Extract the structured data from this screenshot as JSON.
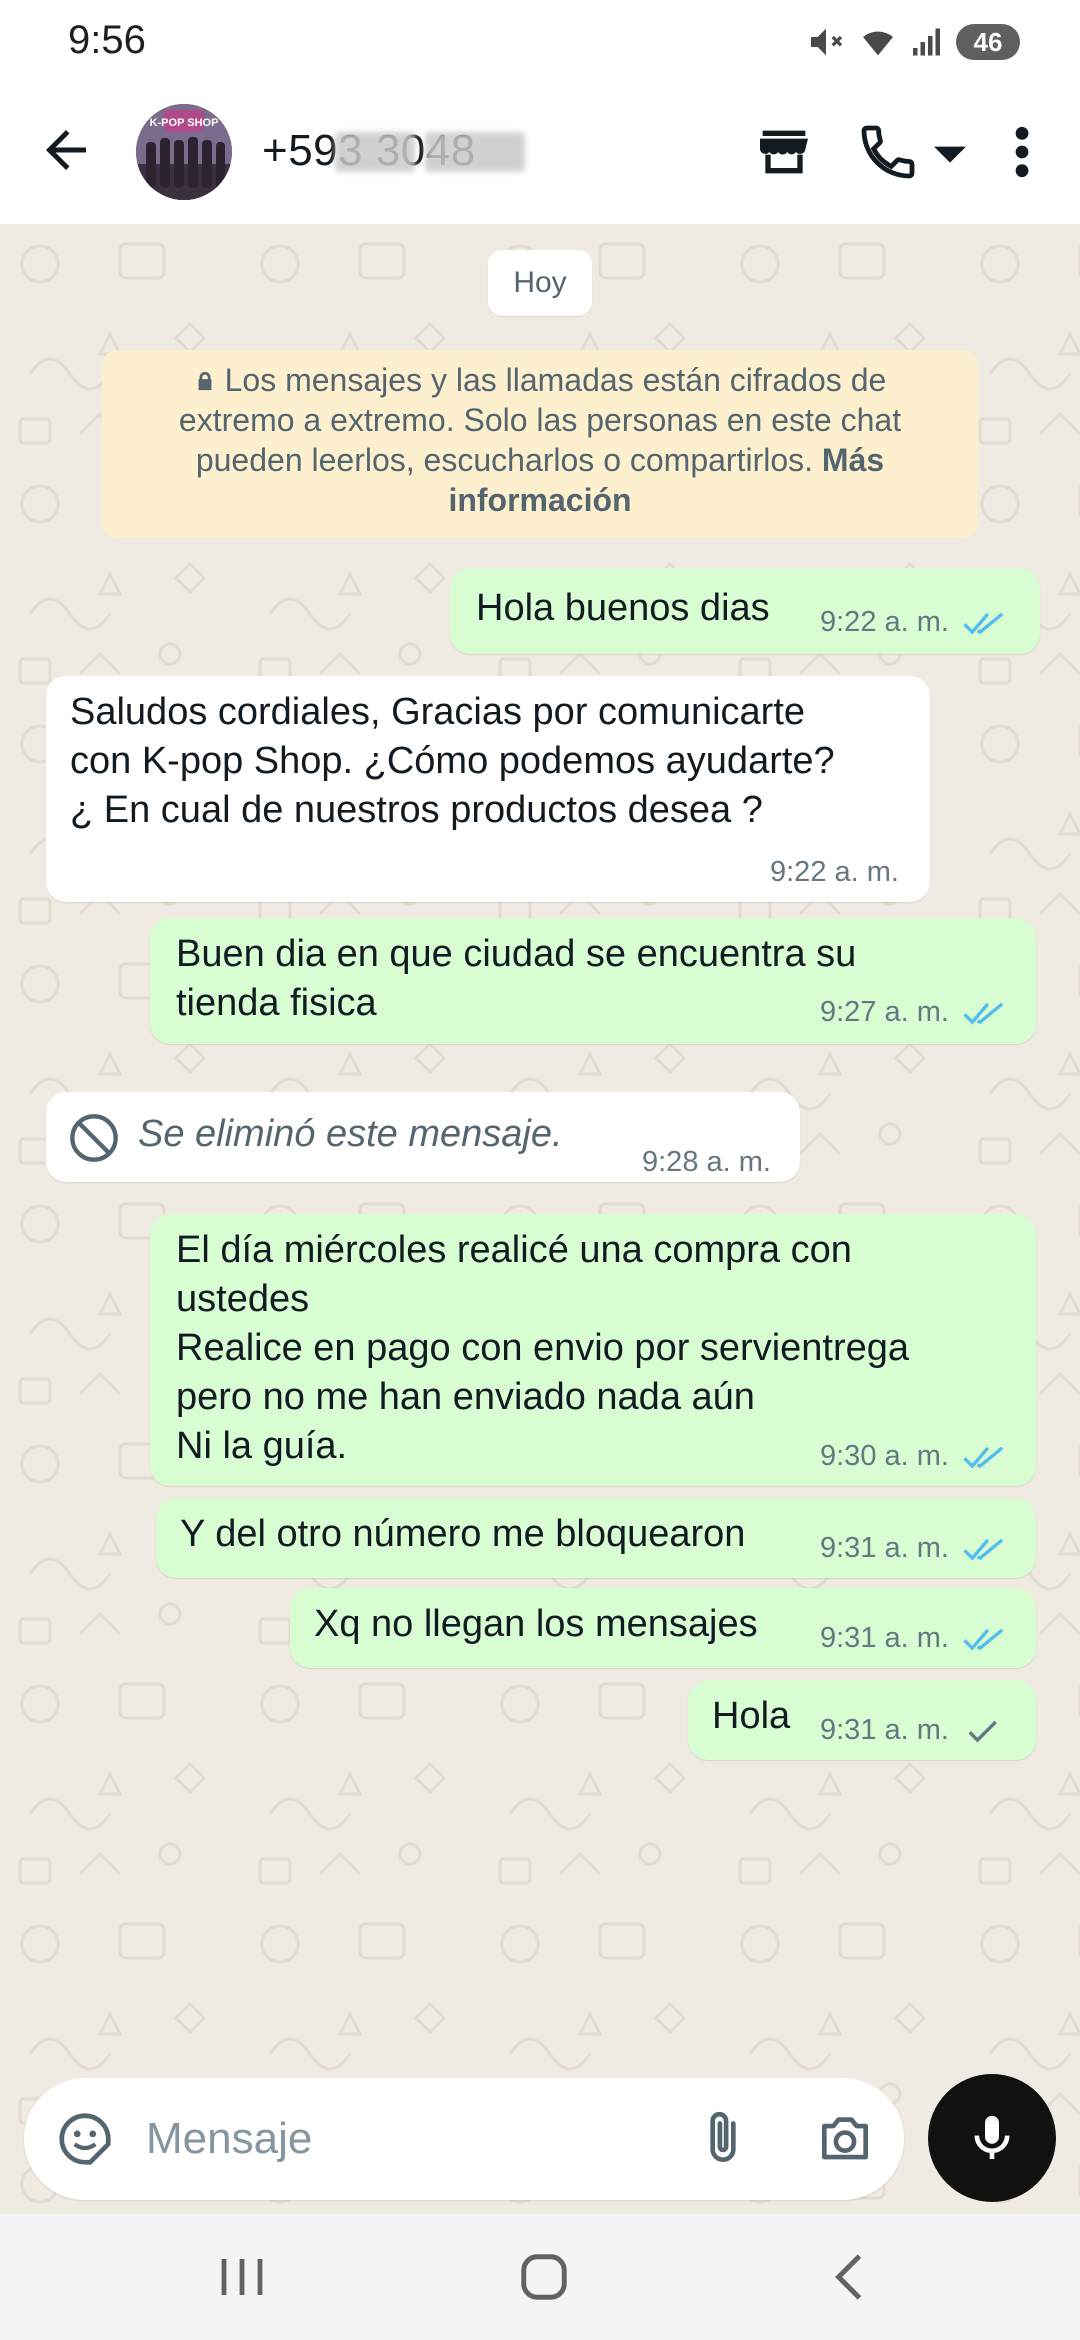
{
  "status_bar": {
    "time": "9:56",
    "battery": "46",
    "icons": [
      "mute-icon",
      "wifi-icon",
      "signal-icon",
      "battery-icon"
    ]
  },
  "header": {
    "back_icon": "arrow-left-icon",
    "avatar_label": "K-POP SHOP",
    "contact_name": "+593          3048",
    "actions": [
      "store-icon",
      "phone-icon",
      "dropdown-icon",
      "more-vert-icon"
    ]
  },
  "chat": {
    "date_chip": "Hoy",
    "encryption_notice": {
      "text": "Los mensajes y las llamadas están cifrados de extremo a extremo. Solo las personas en este chat pueden leerlos, escucharlos o compartirlos.",
      "link": "Más información"
    },
    "messages": [
      {
        "direction": "out",
        "text": "Hola buenos dias",
        "time": "9:22 a. m.",
        "status": "read"
      },
      {
        "direction": "in",
        "text": "Saludos cordiales, Gracias por comunicarte\ncon K-pop Shop. ¿Cómo podemos ayudarte?\n¿ En cual de nuestros productos desea ?",
        "time": "9:22 a. m."
      },
      {
        "direction": "out",
        "text": "Buen dia en que ciudad se encuentra su\ntienda fisica",
        "time": "9:27 a. m.",
        "status": "read"
      },
      {
        "direction": "in",
        "text": "Se eliminó este mensaje.",
        "time": "9:28 a. m.",
        "deleted": true
      },
      {
        "direction": "out",
        "text": "El día miércoles realicé una compra con\nustedes\nRealice en pago con envio por servientrega\npero no me han enviado nada aún\nNi la guía.",
        "time": "9:30 a. m.",
        "status": "read"
      },
      {
        "direction": "out",
        "text": "Y del otro número me bloquearon",
        "time": "9:31 a. m.",
        "status": "read"
      },
      {
        "direction": "out",
        "text": "Xq no llegan los mensajes",
        "time": "9:31 a. m.",
        "status": "read"
      },
      {
        "direction": "out",
        "text": "Hola",
        "time": "9:31 a. m.",
        "status": "sent"
      }
    ]
  },
  "composer": {
    "placeholder": "Mensaje",
    "icons": [
      "sticker-icon",
      "attach-icon",
      "camera-icon",
      "mic-icon"
    ]
  },
  "nav_bar": {
    "icons": [
      "recents-icon",
      "home-icon",
      "back-icon"
    ]
  },
  "colors": {
    "outgoing_bubble": "#d9fdd3",
    "incoming_bubble": "#ffffff",
    "chat_background": "#efeae2",
    "read_tick": "#53bdeb",
    "notice_background": "#fdf0cf"
  }
}
